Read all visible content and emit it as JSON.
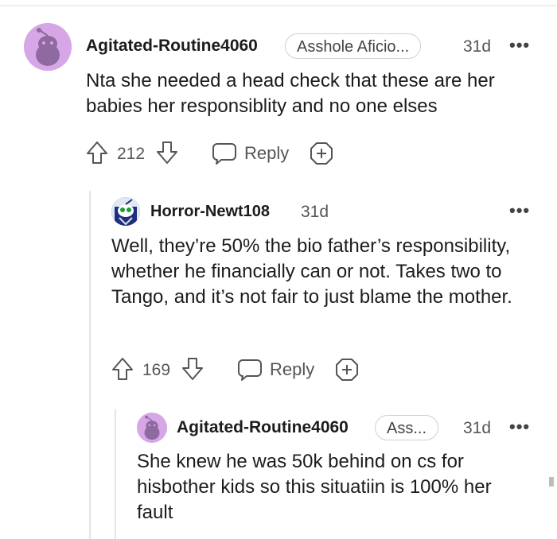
{
  "comments": [
    {
      "username": "Agitated-Routine4060",
      "flair": "Asshole Aficio...",
      "age": "31d",
      "more": "•••",
      "body": "Nta she needed a head check that these are her babies her responsiblity and no one elses",
      "votes": "212",
      "reply_label": "Reply"
    },
    {
      "username": "Horror-Newt108",
      "age": "31d",
      "more": "•••",
      "body": "Well, they’re 50% the bio father’s responsibility, whether he financially can or not. Takes two to Tango, and it’s not fair to just blame the mother.",
      "votes": "169",
      "reply_label": "Reply"
    },
    {
      "username": "Agitated-Routine4060",
      "flair": "Ass...",
      "age": "31d",
      "more": "•••",
      "body": "She knew he was 50k behind on cs for hisbother kids so this situatiin is 100% her fault"
    }
  ],
  "icons": {
    "upvote": "arrow-up-icon",
    "downvote": "arrow-down-icon",
    "reply": "speech-bubble-icon",
    "award": "award-plus-icon",
    "avatar": "snoo-avatar-icon"
  },
  "colors": {
    "avatar_bg": "#d7a6e6",
    "avatar_fg": "#8e6aa0",
    "text": "#1c1c1c",
    "meta": "#555555",
    "thread_line": "#e4e4e4"
  }
}
